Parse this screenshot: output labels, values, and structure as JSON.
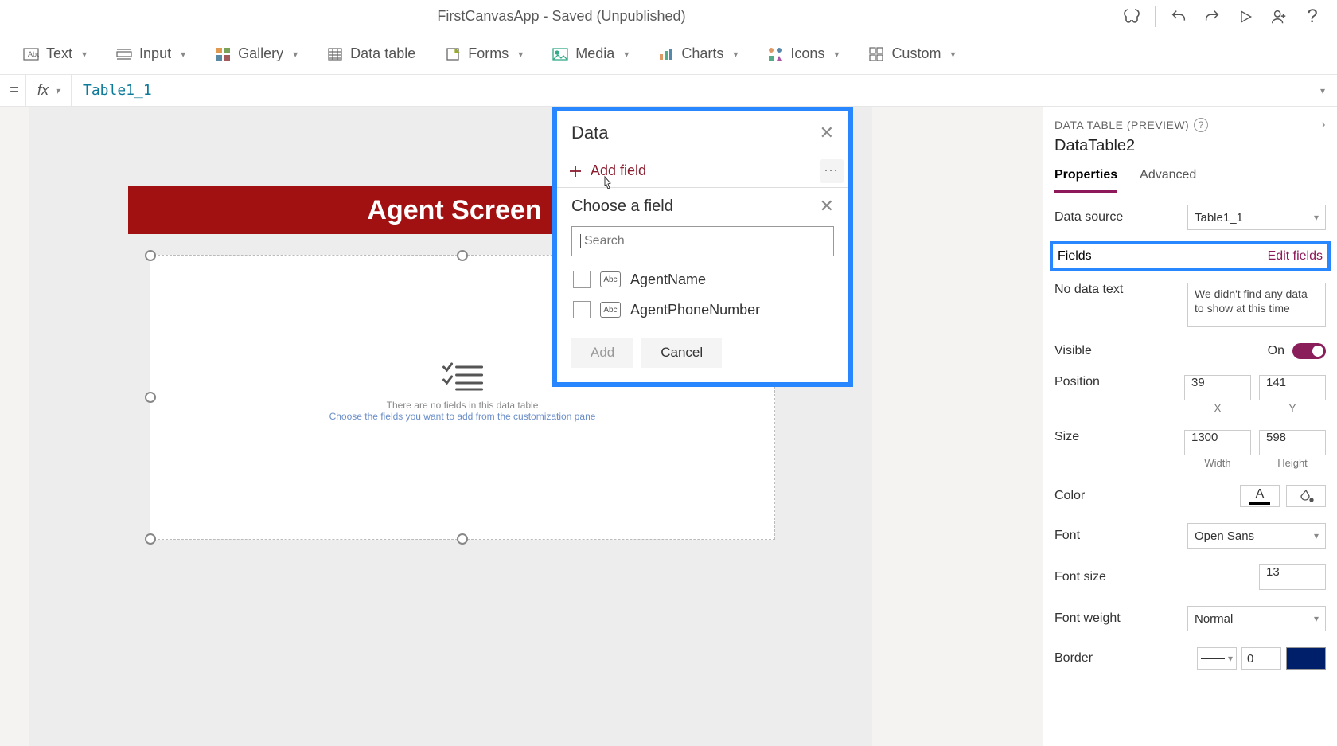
{
  "titlebar": {
    "title": "FirstCanvasApp - Saved (Unpublished)"
  },
  "ribbon": {
    "text": "Text",
    "input": "Input",
    "gallery": "Gallery",
    "dataTable": "Data table",
    "forms": "Forms",
    "media": "Media",
    "charts": "Charts",
    "icons": "Icons",
    "custom": "Custom"
  },
  "formula": {
    "value": "Table1_1"
  },
  "canvas": {
    "headerTitle": "Agent Screen",
    "emptyLine1": "There are no fields in this data table",
    "emptyLine2": "Choose the fields you want to add from the customization pane"
  },
  "dataPanel": {
    "title": "Data",
    "addField": "Add field",
    "chooseField": "Choose a field",
    "searchPlaceholder": "Search",
    "fields": [
      {
        "label": "AgentName"
      },
      {
        "label": "AgentPhoneNumber"
      }
    ],
    "addBtn": "Add",
    "cancelBtn": "Cancel"
  },
  "props": {
    "headLabel": "DATA TABLE (PREVIEW)",
    "controlName": "DataTable2",
    "tabProperties": "Properties",
    "tabAdvanced": "Advanced",
    "dataSourceLabel": "Data source",
    "dataSourceValue": "Table1_1",
    "fieldsLabel": "Fields",
    "editFields": "Edit fields",
    "noDataLabel": "No data text",
    "noDataValue": "We didn't find any data to show at this time",
    "visibleLabel": "Visible",
    "visibleOn": "On",
    "positionLabel": "Position",
    "positionX": "39",
    "positionY": "141",
    "xLabel": "X",
    "yLabel": "Y",
    "sizeLabel": "Size",
    "sizeW": "1300",
    "sizeH": "598",
    "wLabel": "Width",
    "hLabel": "Height",
    "colorLabel": "Color",
    "fontLabel": "Font",
    "fontValue": "Open Sans",
    "fontSizeLabel": "Font size",
    "fontSizeValue": "13",
    "fontWeightLabel": "Font weight",
    "fontWeightValue": "Normal",
    "borderLabel": "Border",
    "borderWidth": "0"
  }
}
